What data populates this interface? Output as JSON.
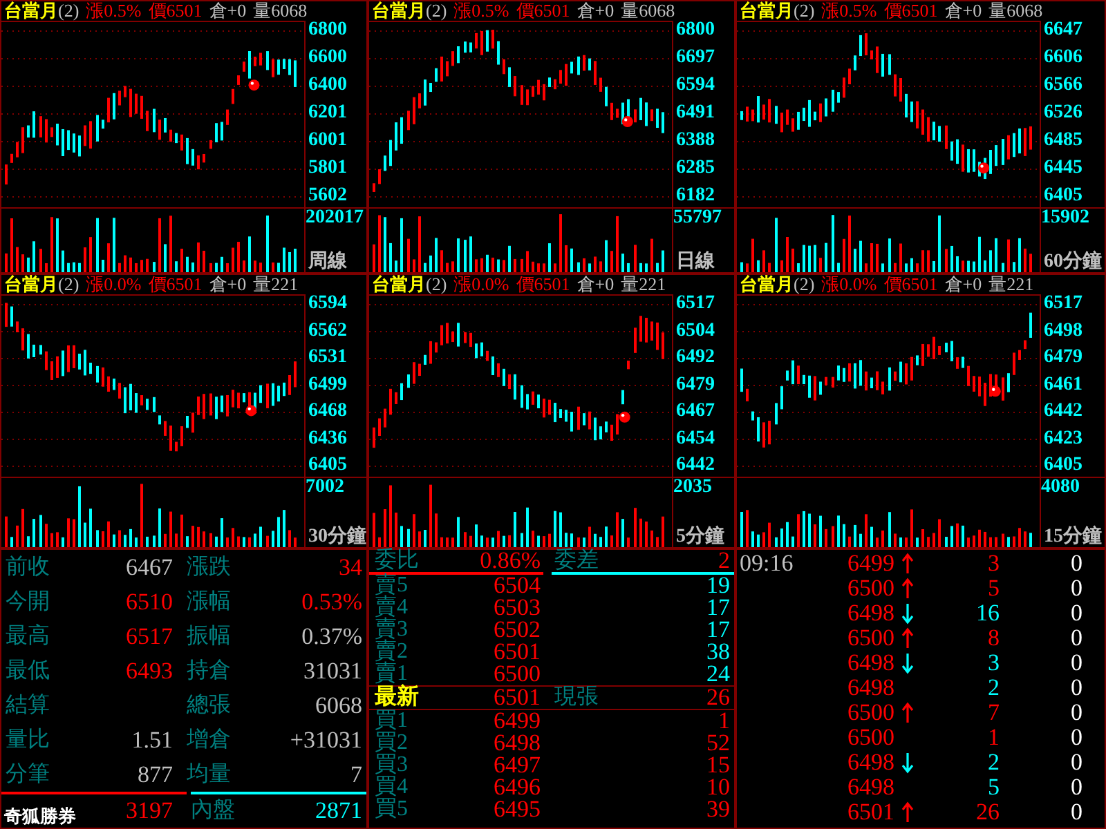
{
  "charts": [
    {
      "symbol": "台當月",
      "contract": "(2)",
      "change": "漲0.5%",
      "price": "價6501",
      "open_interest": "倉+0",
      "volume": "量6068",
      "price_axis": [
        "6800",
        "6600",
        "6400",
        "6201",
        "6001",
        "5801",
        "5602"
      ],
      "volume_max": "202017",
      "period": "周線"
    },
    {
      "symbol": "台當月",
      "contract": "(2)",
      "change": "漲0.5%",
      "price": "價6501",
      "open_interest": "倉+0",
      "volume": "量6068",
      "price_axis": [
        "6800",
        "6697",
        "6594",
        "6491",
        "6388",
        "6285",
        "6182"
      ],
      "volume_max": "55797",
      "period": "日線"
    },
    {
      "symbol": "台當月",
      "contract": "(2)",
      "change": "漲0.5%",
      "price": "價6501",
      "open_interest": "倉+0",
      "volume": "量6068",
      "price_axis": [
        "6647",
        "6606",
        "6566",
        "6526",
        "6485",
        "6445",
        "6405"
      ],
      "volume_max": "15902",
      "period": "60分鐘"
    },
    {
      "symbol": "台當月",
      "contract": "(2)",
      "change": "漲0.0%",
      "price": "價6501",
      "open_interest": "倉+0",
      "volume": "量221",
      "price_axis": [
        "6594",
        "6562",
        "6531",
        "6499",
        "6468",
        "6436",
        "6405"
      ],
      "volume_max": "7002",
      "period": "30分鐘"
    },
    {
      "symbol": "台當月",
      "contract": "(2)",
      "change": "漲0.0%",
      "price": "價6501",
      "open_interest": "倉+0",
      "volume": "量221",
      "price_axis": [
        "6517",
        "6504",
        "6492",
        "6479",
        "6467",
        "6454",
        "6442"
      ],
      "volume_max": "2035",
      "period": "5分鐘"
    },
    {
      "symbol": "台當月",
      "contract": "(2)",
      "change": "漲0.0%",
      "price": "價6501",
      "open_interest": "倉+0",
      "volume": "量221",
      "price_axis": [
        "6517",
        "6498",
        "6479",
        "6461",
        "6442",
        "6423",
        "6405"
      ],
      "volume_max": "4080",
      "period": "15分鐘"
    }
  ],
  "quote": {
    "rows": [
      {
        "left": {
          "label": "前收",
          "value": "6467",
          "color": "#c0c0c0"
        },
        "right": {
          "label": "漲跌",
          "value": "34",
          "color": "#ff0000"
        }
      },
      {
        "left": {
          "label": "今開",
          "value": "6510",
          "color": "#ff0000"
        },
        "right": {
          "label": "漲幅",
          "value": "0.53%",
          "color": "#ff0000"
        }
      },
      {
        "left": {
          "label": "最高",
          "value": "6517",
          "color": "#ff0000"
        },
        "right": {
          "label": "振幅",
          "value": "0.37%",
          "color": "#c0c0c0"
        }
      },
      {
        "left": {
          "label": "最低",
          "value": "6493",
          "color": "#ff0000"
        },
        "right": {
          "label": "持倉",
          "value": "31031",
          "color": "#c0c0c0"
        }
      },
      {
        "left": {
          "label": "結算"
        },
        "right": {
          "label": "總張",
          "value": "6068",
          "color": "#c0c0c0"
        }
      },
      {
        "left": {
          "label": "量比",
          "value": "1.51",
          "color": "#c0c0c0"
        },
        "right": {
          "label": "增倉",
          "value": "+31031",
          "color": "#c0c0c0"
        }
      },
      {
        "left": {
          "label": "分筆",
          "value": "877",
          "color": "#c0c0c0"
        },
        "right": {
          "label": "均量",
          "value": "7",
          "color": "#c0c0c0"
        }
      },
      {
        "left": {
          "value": "3197",
          "color": "#ff0000"
        },
        "right": {
          "label": "內盤",
          "value": "2871",
          "color": "#00ffff"
        }
      }
    ],
    "brand_label": "奇狐勝券"
  },
  "order_book": {
    "ratio_label": "委比",
    "ratio": "0.86%",
    "diff_label": "委差",
    "diff": "2",
    "asks": [
      {
        "label": "賣5",
        "price": "6504",
        "volume": "19"
      },
      {
        "label": "賣4",
        "price": "6503",
        "volume": "17"
      },
      {
        "label": "賣3",
        "price": "6502",
        "volume": "17"
      },
      {
        "label": "賣2",
        "price": "6501",
        "volume": "38"
      },
      {
        "label": "賣1",
        "price": "6500",
        "volume": "24"
      }
    ],
    "last": {
      "label": "最新",
      "price": "6501",
      "volume_label": "現張",
      "volume": "26"
    },
    "bids": [
      {
        "label": "買1",
        "price": "6499",
        "volume": "1"
      },
      {
        "label": "買2",
        "price": "6498",
        "volume": "52"
      },
      {
        "label": "買3",
        "price": "6497",
        "volume": "15"
      },
      {
        "label": "買4",
        "price": "6496",
        "volume": "10"
      },
      {
        "label": "買5",
        "price": "6495",
        "volume": "39"
      }
    ]
  },
  "ticks": {
    "time": "09:16",
    "rows": [
      {
        "price": "6499",
        "kind": "up",
        "volume": "3",
        "color": "#ff0000",
        "column_4": "0"
      },
      {
        "price": "6500",
        "kind": "up",
        "volume": "5",
        "color": "#ff0000",
        "column_4": "0"
      },
      {
        "price": "6498",
        "kind": "down",
        "volume": "16",
        "color": "#00ffff",
        "column_4": "0"
      },
      {
        "price": "6500",
        "kind": "up",
        "volume": "8",
        "color": "#ff0000",
        "column_4": "0"
      },
      {
        "price": "6498",
        "kind": "down",
        "volume": "3",
        "color": "#00ffff",
        "column_4": "0"
      },
      {
        "price": "6498",
        "kind": "flat",
        "volume": "2",
        "color": "#00ffff",
        "column_4": "0"
      },
      {
        "price": "6500",
        "kind": "up",
        "volume": "7",
        "color": "#ff0000",
        "column_4": "0"
      },
      {
        "price": "6500",
        "kind": "flat",
        "volume": "1",
        "color": "#ff0000",
        "column_4": "0"
      },
      {
        "price": "6498",
        "kind": "down",
        "volume": "2",
        "color": "#00ffff",
        "column_4": "0"
      },
      {
        "price": "6498",
        "kind": "flat",
        "volume": "5",
        "color": "#00ffff",
        "column_4": "0"
      },
      {
        "price": "6501",
        "kind": "up",
        "volume": "26",
        "color": "#ff0000",
        "column_4": "0"
      }
    ]
  }
}
